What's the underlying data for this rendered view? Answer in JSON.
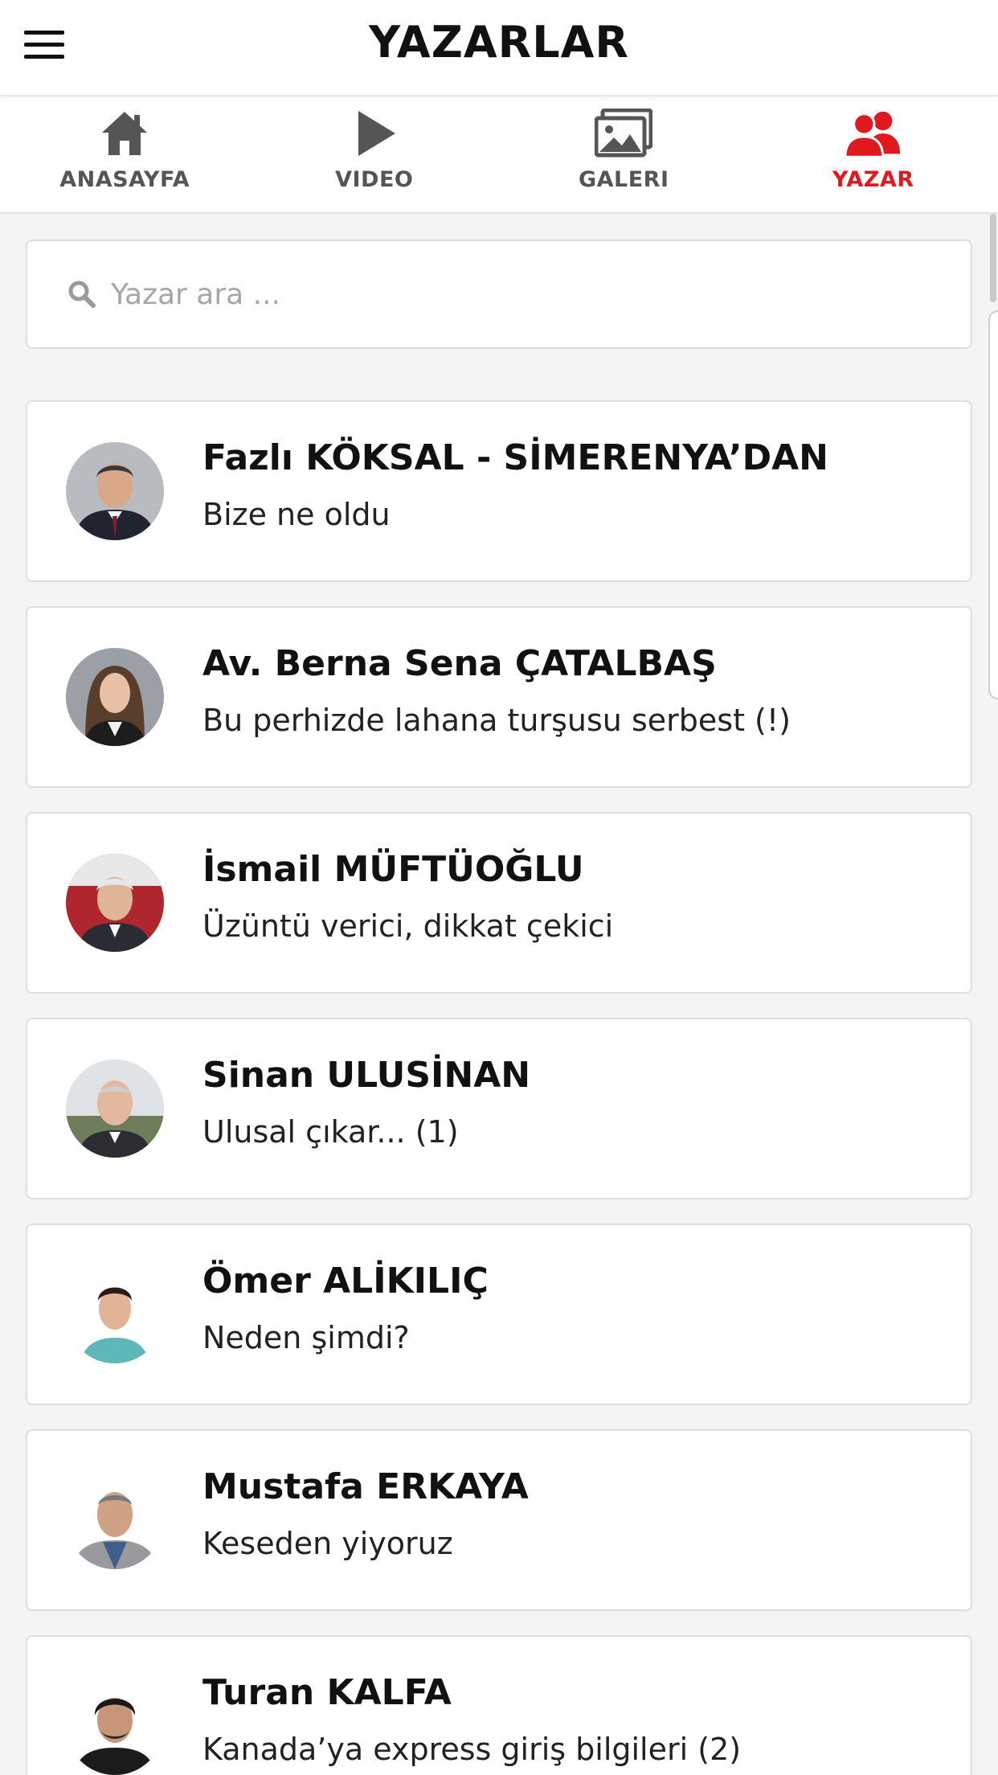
{
  "header": {
    "title": "YAZARLAR",
    "menu_icon": "hamburger-menu-icon"
  },
  "tabs": [
    {
      "label": "ANASAYFA",
      "icon": "home-icon",
      "active": false
    },
    {
      "label": "VIDEO",
      "icon": "play-icon",
      "active": false
    },
    {
      "label": "GALERI",
      "icon": "gallery-icon",
      "active": false
    },
    {
      "label": "YAZAR",
      "icon": "users-icon",
      "active": true
    }
  ],
  "colors": {
    "accent": "#e0191f",
    "tab_inactive": "#555555"
  },
  "search": {
    "placeholder": "Yazar ara ...",
    "value": "",
    "icon": "search-icon"
  },
  "authors": [
    {
      "name": "Fazlı KÖKSAL - SİMERENYA’DAN",
      "article": "Bize ne oldu"
    },
    {
      "name": "Av. Berna Sena ÇATALBAŞ",
      "article": "Bu perhizde lahana turşusu serbest (!)"
    },
    {
      "name": "İsmail MÜFTÜOĞLU",
      "article": "Üzüntü verici, dikkat çekici"
    },
    {
      "name": "Sinan ULUSİNAN",
      "article": "Ulusal çıkar... (1)"
    },
    {
      "name": "Ömer ALİKILIÇ",
      "article": "Neden şimdi?"
    },
    {
      "name": "Mustafa ERKAYA",
      "article": "Keseden yiyoruz"
    },
    {
      "name": "Turan KALFA",
      "article": "Kanada’ya express giriş bilgileri (2)"
    }
  ]
}
